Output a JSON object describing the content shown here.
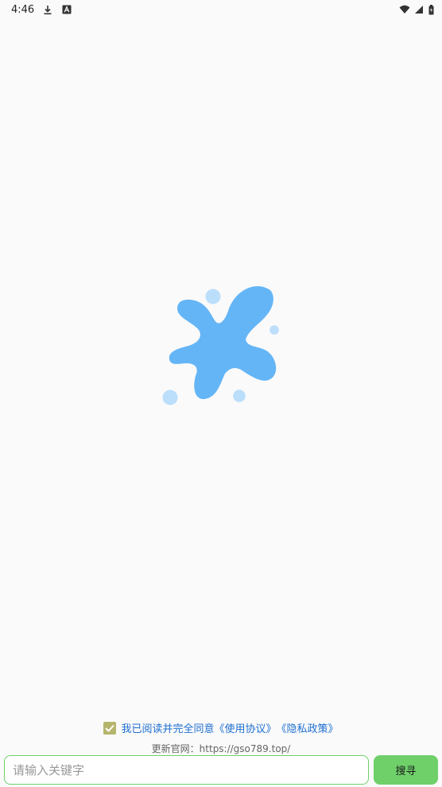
{
  "status_bar": {
    "time": "4:46",
    "left_icons": [
      "download-icon",
      "a-badge-icon"
    ],
    "right_icons": [
      "wifi-icon",
      "cell-signal-icon",
      "battery-icon"
    ]
  },
  "splash": {
    "logo_icon": "splash-logo-icon",
    "colors": {
      "primary": "#64b5f6",
      "light": "#bbdefb"
    }
  },
  "agreement": {
    "checked": true,
    "text": "我已阅读并完全同意",
    "terms_link": "《使用协议》",
    "privacy_link": "《隐私政策》"
  },
  "update": {
    "text": "更新官网：https://gso789.top/"
  },
  "search": {
    "placeholder": "请输入关键字",
    "button_label": "搜寻"
  },
  "colors": {
    "background": "#fafafa",
    "accent_green": "#6fd06a",
    "link_blue": "#1f6fd1",
    "checkbox": "#b5b56e"
  }
}
